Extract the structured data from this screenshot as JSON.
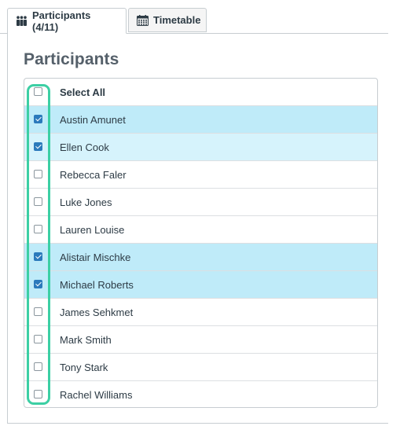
{
  "tabs": [
    {
      "label": "Participants (4/11)",
      "icon": "people-icon",
      "active": true
    },
    {
      "label": "Timetable",
      "icon": "calendar-icon",
      "active": false
    }
  ],
  "panel": {
    "title": "Participants"
  },
  "list": {
    "select_all_label": "Select All",
    "select_all_checked": false,
    "participants": [
      {
        "name": "Austin Amunet",
        "checked": true
      },
      {
        "name": "Ellen Cook",
        "checked": true
      },
      {
        "name": "Rebecca Faler",
        "checked": false
      },
      {
        "name": "Luke Jones",
        "checked": false
      },
      {
        "name": "Lauren Louise",
        "checked": false
      },
      {
        "name": "Alistair Mischke",
        "checked": true
      },
      {
        "name": "Michael Roberts",
        "checked": true
      },
      {
        "name": "James Sehkmet",
        "checked": false
      },
      {
        "name": "Mark Smith",
        "checked": false
      },
      {
        "name": "Tony Stark",
        "checked": false
      },
      {
        "name": "Rachel Williams",
        "checked": false
      }
    ]
  },
  "colors": {
    "selected_row": "#bfebf9",
    "checkbox_checked": "#2b7abc",
    "highlight_outline": "#3ccfa4"
  }
}
